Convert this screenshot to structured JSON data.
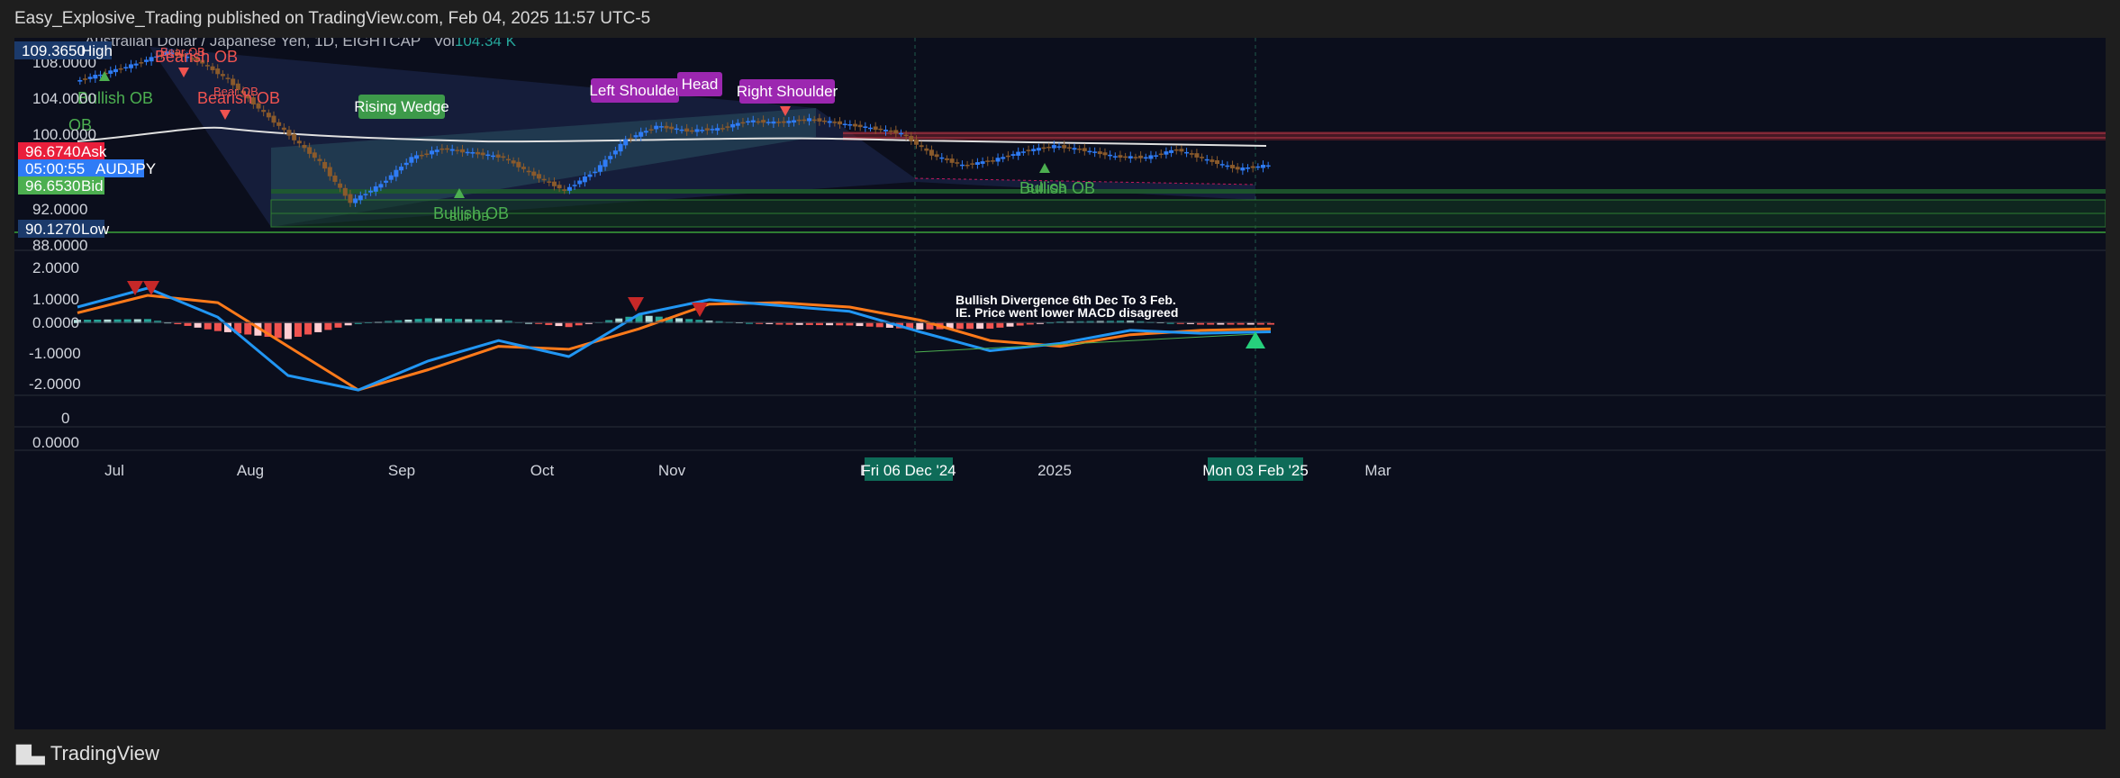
{
  "publication": {
    "text": "Easy_Explosive_Trading published on TradingView.com, Feb 04, 2025 11:57 UTC-5"
  },
  "symbol_info": {
    "title": "Australian Dollar / Japanese Yen, 1D, EIGHTCAP",
    "vol_label": "Vol",
    "vol_value": "104.34 K"
  },
  "price_labels": {
    "high_value": "109.3650",
    "high_label": "High",
    "ask_value": "96.6740",
    "ask_label": "Ask",
    "timer_value": "05:00:55",
    "timer_label": "AUDJPY",
    "bid_value": "96.6530",
    "bid_label": "Bid",
    "low_value": "90.1270",
    "low_label": "Low"
  },
  "annotations": {
    "rising_wedge": "Rising Wedge",
    "left_shoulder": "Left Shoulder",
    "head": "Head",
    "right_shoulder": "Right Shoulder",
    "bullish_ob_1": "Bullish OB",
    "bullish_ob_2": "Bullish OB",
    "bullish_ob_3": "Bullish OB",
    "bullish_ob_3_ghost": "Bull OB",
    "bullish_ob_2_ghost": "Bull OB",
    "ob_partial": "OB",
    "bearish_ob_1": "Bearish OB",
    "bearish_ob_1_ghost": "Bear OB",
    "bearish_ob_2": "Bearish OB",
    "bearish_ob_2_ghost": "Bear OB",
    "divergence_line1": "Bullish Divergence 6th Dec To 3 Feb.",
    "divergence_line2": "IE. Price went lower MACD disagreed"
  },
  "date_markers": {
    "left": "Fri 06 Dec '24",
    "right": "Mon 03 Feb '25"
  },
  "x_axis_labels": [
    "Jul",
    "Aug",
    "Sep",
    "Oct",
    "Nov",
    "D",
    "2025",
    "Mar"
  ],
  "brand": {
    "name": "TradingView"
  },
  "colors": {
    "background": "#0b0e1c",
    "up_candle": "#2f7cf6",
    "down_candle": "#8a5a2b",
    "macd_line": "#2196f3",
    "signal_line": "#ff7a1a",
    "hist_pos": "#26a69a",
    "hist_neg": "#ef5350",
    "pattern_label": "#9c27b0",
    "wedge_label": "#4caf50",
    "date_marker": "#0e6b58"
  },
  "chart_data": [
    {
      "type": "candlestick",
      "title": "Australian Dollar / Japanese Yen, 1D, EIGHTCAP",
      "x_axis_labels": [
        "Jul",
        "Aug",
        "Sep",
        "Oct",
        "Nov",
        "D",
        "2025",
        "Mar"
      ],
      "y_tick_labels": [
        "108.0000",
        "104.0000",
        "100.0000",
        "92.0000",
        "88.0000"
      ],
      "ylim": [
        87.5,
        110.5
      ],
      "grid": false,
      "close_path": [
        {
          "x": "Jun 28",
          "y": 106.0
        },
        {
          "x": "Jul 03",
          "y": 107.0
        },
        {
          "x": "Jul 08",
          "y": 108.0
        },
        {
          "x": "Jul 11",
          "y": 109.3
        },
        {
          "x": "Jul 15",
          "y": 108.4
        },
        {
          "x": "Jul 19",
          "y": 106.2
        },
        {
          "x": "Jul 24",
          "y": 103.0
        },
        {
          "x": "Jul 29",
          "y": 100.0
        },
        {
          "x": "Aug 02",
          "y": 97.0
        },
        {
          "x": "Aug 05",
          "y": 92.5
        },
        {
          "x": "Aug 08",
          "y": 94.5
        },
        {
          "x": "Aug 14",
          "y": 97.5
        },
        {
          "x": "Aug 20",
          "y": 98.5
        },
        {
          "x": "Aug 27",
          "y": 98.0
        },
        {
          "x": "Sep 03",
          "y": 97.5
        },
        {
          "x": "Sep 09",
          "y": 95.5
        },
        {
          "x": "Sep 16",
          "y": 93.8
        },
        {
          "x": "Sep 20",
          "y": 96.0
        },
        {
          "x": "Sep 26",
          "y": 99.5
        },
        {
          "x": "Oct 03",
          "y": 101.0
        },
        {
          "x": "Oct 10",
          "y": 100.5
        },
        {
          "x": "Oct 17",
          "y": 100.7
        },
        {
          "x": "Oct 24",
          "y": 101.6
        },
        {
          "x": "Oct 30",
          "y": 101.4
        },
        {
          "x": "Nov 06",
          "y": 101.8
        },
        {
          "x": "Nov 12",
          "y": 101.3
        },
        {
          "x": "Nov 19",
          "y": 100.8
        },
        {
          "x": "Nov 26",
          "y": 100.2
        },
        {
          "x": "Dec 02",
          "y": 97.8
        },
        {
          "x": "Dec 06",
          "y": 96.6
        },
        {
          "x": "Dec 13",
          "y": 97.2
        },
        {
          "x": "Dec 20",
          "y": 98.2
        },
        {
          "x": "Dec 27",
          "y": 98.8
        },
        {
          "x": "Jan 03",
          "y": 98.3
        },
        {
          "x": "Jan 10",
          "y": 97.6
        },
        {
          "x": "Jan 17",
          "y": 97.5
        },
        {
          "x": "Jan 24",
          "y": 98.4
        },
        {
          "x": "Jan 30",
          "y": 97.2
        },
        {
          "x": "Feb 03",
          "y": 96.2
        },
        {
          "x": "Feb 04",
          "y": 96.65
        }
      ],
      "moving_average_approx": 100.2,
      "high": 109.365,
      "low": 90.127
    },
    {
      "type": "line",
      "title": "MACD",
      "y_tick_labels": [
        "2.0000",
        "1.0000",
        "0.0000",
        "-1.0000",
        "-2.0000"
      ],
      "ylim": [
        -2.45,
        2.25
      ],
      "series": [
        {
          "values": [
            0.55,
            1.2,
            0.2,
            -1.8,
            -2.3,
            -1.3,
            -0.6,
            -1.15,
            0.3,
            0.8,
            0.6,
            0.4,
            -0.3,
            -0.95,
            -0.7,
            -0.25,
            -0.35,
            -0.3
          ]
        },
        {
          "values": [
            0.35,
            0.95,
            0.7,
            -0.8,
            -2.3,
            -1.6,
            -0.8,
            -0.9,
            -0.2,
            0.65,
            0.7,
            0.55,
            0.1,
            -0.6,
            -0.8,
            -0.4,
            -0.25,
            -0.2
          ]
        }
      ],
      "histogram_sign": [
        "+",
        "+",
        "-",
        "-",
        "-",
        "+",
        "+",
        "+",
        "+",
        "+",
        "-",
        "-",
        "-",
        "-",
        "+",
        "+",
        "-",
        "-"
      ]
    }
  ]
}
